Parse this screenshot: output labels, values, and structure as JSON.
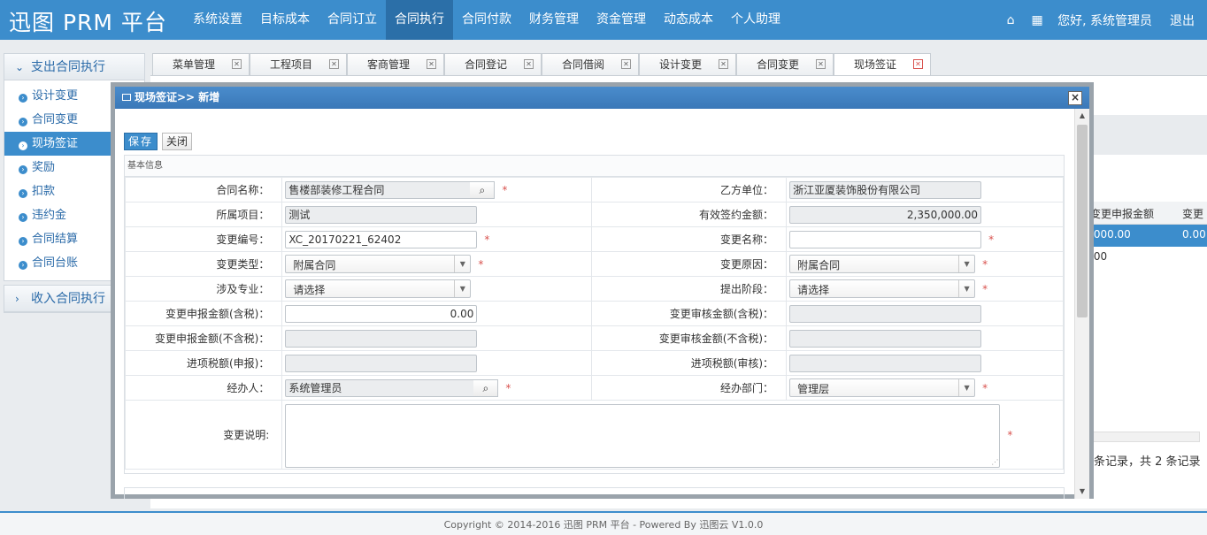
{
  "app": {
    "title": "迅图 PRM 平台"
  },
  "nav": {
    "items": [
      "系统设置",
      "目标成本",
      "合同订立",
      "合同执行",
      "合同付款",
      "财务管理",
      "资金管理",
      "动态成本",
      "个人助理"
    ]
  },
  "topright": {
    "greeting": "您好, 系统管理员",
    "logout": "退出"
  },
  "sidebar": {
    "section1": "支出合同执行",
    "items": [
      "设计变更",
      "合同变更",
      "现场签证",
      "奖励",
      "扣款",
      "违约金",
      "合同结算",
      "合同台账"
    ],
    "section2": "收入合同执行"
  },
  "tabs": [
    "菜单管理",
    "工程项目",
    "客商管理",
    "合同登记",
    "合同借阅",
    "设计变更",
    "合同变更",
    "现场签证"
  ],
  "background_grid": {
    "col1": "变更申报金额",
    "col2": "变更",
    "row1": [
      ".000.00",
      "0.00"
    ],
    "row2": [
      ".00"
    ],
    "pager": "条记录，共 2 条记录"
  },
  "modal": {
    "title": "现场签证>> 新增",
    "save": "保存",
    "close": "关闭",
    "section": "基本信息"
  },
  "form": {
    "contract_name_label": "合同名称：",
    "contract_name": "售楼部装修工程合同",
    "party_b_label": "乙方单位：",
    "party_b": "浙江亚厦装饰股份有限公司",
    "project_label": "所属项目：",
    "project": "测试",
    "valid_amount_label": "有效签约金额：",
    "valid_amount": "2,350,000.00",
    "change_no_label": "变更编号：",
    "change_no": "XC_20170221_62402",
    "change_name_label": "变更名称：",
    "change_name": "",
    "change_type_label": "变更类型：",
    "change_type": "附属合同",
    "change_reason_label": "变更原因：",
    "change_reason": "附属合同",
    "specialty_label": "涉及专业：",
    "specialty": "请选择",
    "stage_label": "提出阶段：",
    "stage": "请选择",
    "declared_tax_label": "变更申报金额(含税)：",
    "declared_tax": "0.00",
    "audited_tax_label": "变更审核金额(含税)：",
    "declared_notax_label": "变更申报金额(不含税)：",
    "audited_notax_label": "变更审核金额(不含税)：",
    "input_tax_declared_label": "进项税额(申报)：",
    "input_tax_audited_label": "进项税额(审核)：",
    "handler_label": "经办人：",
    "handler": "系统管理员",
    "dept_label": "经办部门：",
    "dept": "管理层",
    "desc_label": "变更说明:",
    "required_mark": "*"
  },
  "footer": {
    "text": "Copyright © 2014-2016 迅图 PRM 平台 - Powered By 迅图云 V1.0.0"
  }
}
